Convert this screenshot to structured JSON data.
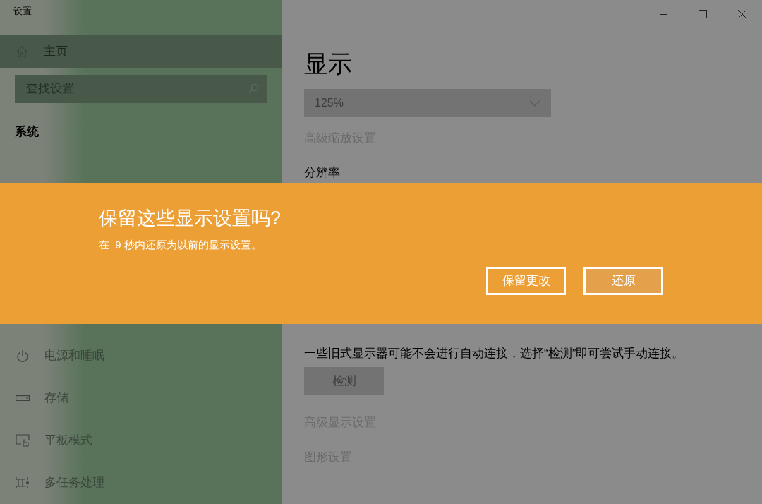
{
  "window": {
    "title": "设置"
  },
  "sidebar": {
    "home": {
      "label": "主页",
      "selected": true
    },
    "search": {
      "placeholder": "查找设置"
    },
    "section": "系统",
    "items": [
      {
        "label": "电源和睡眠"
      },
      {
        "label": "存储"
      },
      {
        "label": "平板模式"
      },
      {
        "label": "多任务处理"
      }
    ]
  },
  "main": {
    "title": "显示",
    "scale_dropdown": {
      "value": "125%"
    },
    "advanced_scaling_link": "高级缩放设置",
    "resolution_label": "分辨率",
    "detect_description": "一些旧式显示器可能不会进行自动连接，选择“检测”即可尝试手动连接。",
    "detect_button": "检测",
    "links": [
      "高级显示设置",
      "图形设置"
    ]
  },
  "dialog": {
    "title": "保留这些显示设置吗?",
    "message": "在  9 秒内还原为以前的显示设置。",
    "buttons": [
      {
        "label": "保留更改",
        "selected": false
      },
      {
        "label": "还原",
        "selected": true
      }
    ]
  }
}
